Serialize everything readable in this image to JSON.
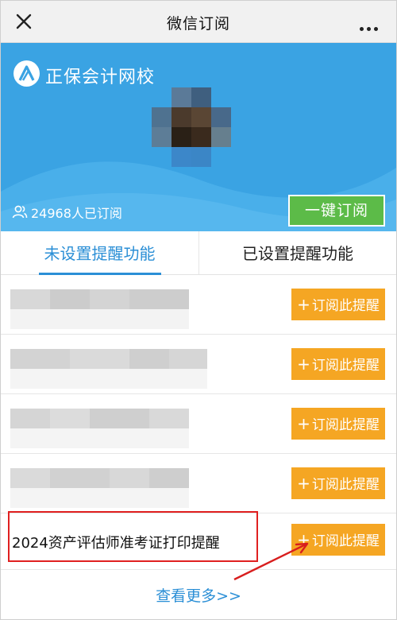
{
  "titlebar": {
    "title": "微信订阅",
    "close_icon": "close-icon",
    "more_icon": "more-dots-icon"
  },
  "hero": {
    "brand_name": "正保会计网校",
    "brand_logo": "brand-logo-icon",
    "subscriber_text": "24968人已订阅",
    "subscriber_icon": "people-icon",
    "subscribe_all_label": "一键订阅",
    "colors": {
      "background": "#3aa3e3",
      "subscribe_button": "#5cbb48"
    }
  },
  "tabs": [
    {
      "label": "未设置提醒功能",
      "active": true
    },
    {
      "label": "已设置提醒功能",
      "active": false
    }
  ],
  "list": {
    "items": [
      {
        "title": "",
        "button": "订阅此提醒"
      },
      {
        "title": "",
        "button": "订阅此提醒"
      },
      {
        "title": "",
        "button": "订阅此提醒"
      },
      {
        "title": "",
        "button": "订阅此提醒"
      },
      {
        "title": "2024资产评估师准考证打印提醒",
        "button": "订阅此提醒"
      }
    ],
    "button_plus": "+",
    "button_color": "#f5a623"
  },
  "see_more": "查看更多>>",
  "annotation": {
    "highlight_color": "#e02020"
  }
}
